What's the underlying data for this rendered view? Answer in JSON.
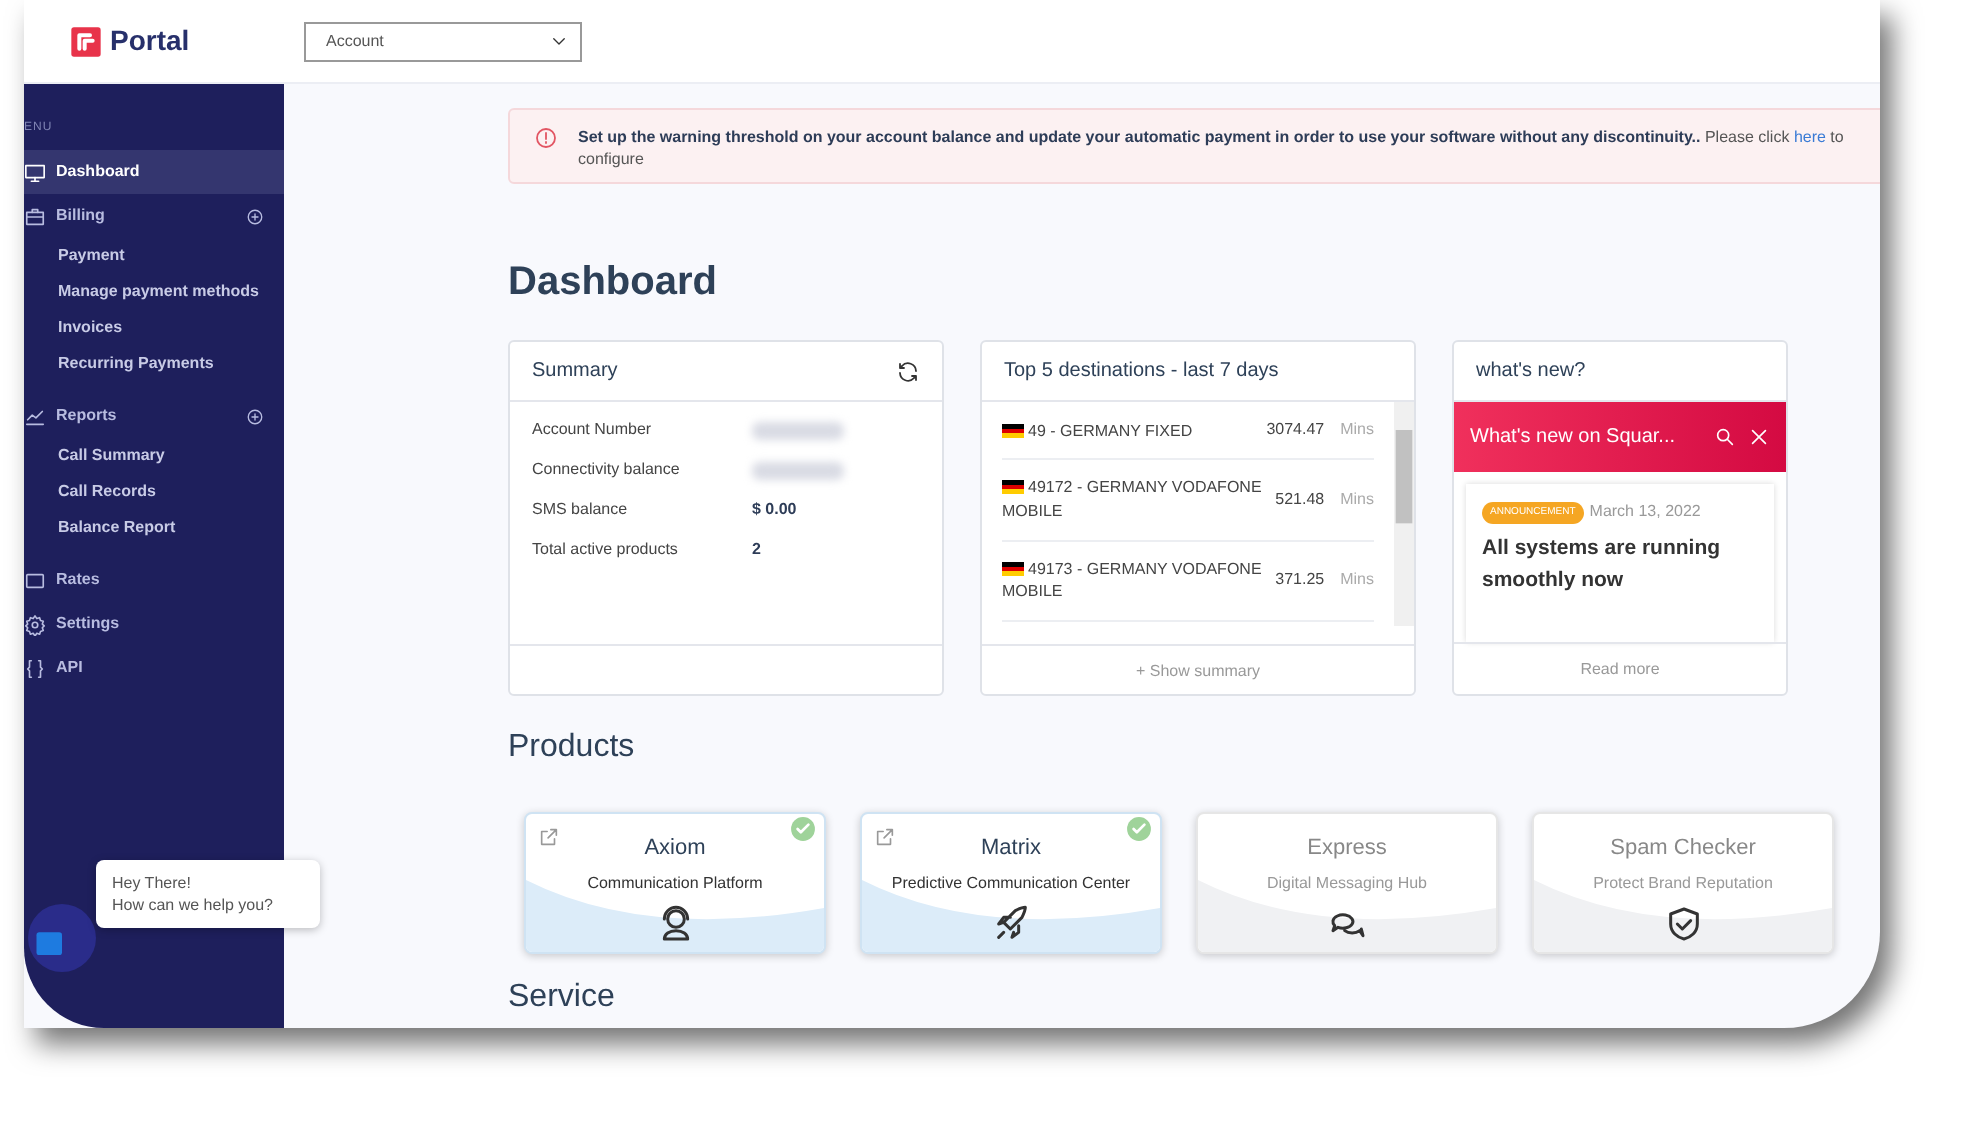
{
  "header": {
    "logo": "Portal",
    "account_select": {
      "value": "Account"
    }
  },
  "sidebar": {
    "section_label": "ENU",
    "items": [
      {
        "label": "Dashboard",
        "selected": true
      },
      {
        "label": "Billing",
        "selected": false,
        "expandable": true,
        "children": [
          {
            "label": "Payment"
          },
          {
            "label": "Manage payment methods"
          },
          {
            "label": "Invoices"
          },
          {
            "label": "Recurring Payments"
          }
        ]
      },
      {
        "label": "Reports",
        "selected": false,
        "expandable": true,
        "children": [
          {
            "label": "Call Summary"
          },
          {
            "label": "Call Records"
          },
          {
            "label": "Balance Report"
          }
        ]
      },
      {
        "label": "Rates",
        "selected": false
      },
      {
        "label": "Settings",
        "selected": false
      },
      {
        "label": "API",
        "selected": false
      }
    ]
  },
  "alert": {
    "text": "**Set up the warning threshold on your account balance and update your automatic payment in order to use your software without any discontinuity..** Please click",
    "link": "here",
    "after": "to configure"
  },
  "page_title": "Dashboard",
  "summary": {
    "title": "Summary",
    "rows": [
      {
        "label": "Account Number",
        "blurred": true
      },
      {
        "label": "Connectivity balance",
        "blurred": true
      },
      {
        "label": "SMS balance",
        "value": "$ 0.00",
        "blurred": false
      },
      {
        "label": "Total active products",
        "value": "2",
        "blurred": false
      }
    ]
  },
  "destinations": {
    "title": "Top 5 destinations - last 7 days",
    "rows": [
      {
        "name": "49 - GERMANY FIXED",
        "minutes": "3074.47",
        "unit": "Mins"
      },
      {
        "name": "49172 - GERMANY VODAFONE MOBILE",
        "minutes": "521.48",
        "unit": "Mins"
      },
      {
        "name": "49173 - GERMANY VODAFONE MOBILE",
        "minutes": "371.25",
        "unit": "Mins"
      }
    ],
    "footer": "+ Show summary"
  },
  "news": {
    "title": "what's new?",
    "banner": "What's new on Squar...",
    "item": {
      "tag": "ANNOUNCEMENT",
      "date": "March 13, 2022",
      "headline": "All systems are running smoothly now"
    },
    "footer": "Read more"
  },
  "products_title": "Products",
  "products": [
    {
      "name": "Axiom",
      "subtitle": "Communication Platform",
      "active": true
    },
    {
      "name": "Matrix",
      "subtitle": "Predictive Communication Center",
      "active": true
    },
    {
      "name": "Express",
      "subtitle": "Digital Messaging Hub",
      "active": false
    },
    {
      "name": "Spam Checker",
      "subtitle": "Protect Brand Reputation",
      "active": false
    }
  ],
  "service_title": "Service",
  "chat": {
    "greeting": "Hey There!",
    "prompt": "How can we help you?"
  }
}
